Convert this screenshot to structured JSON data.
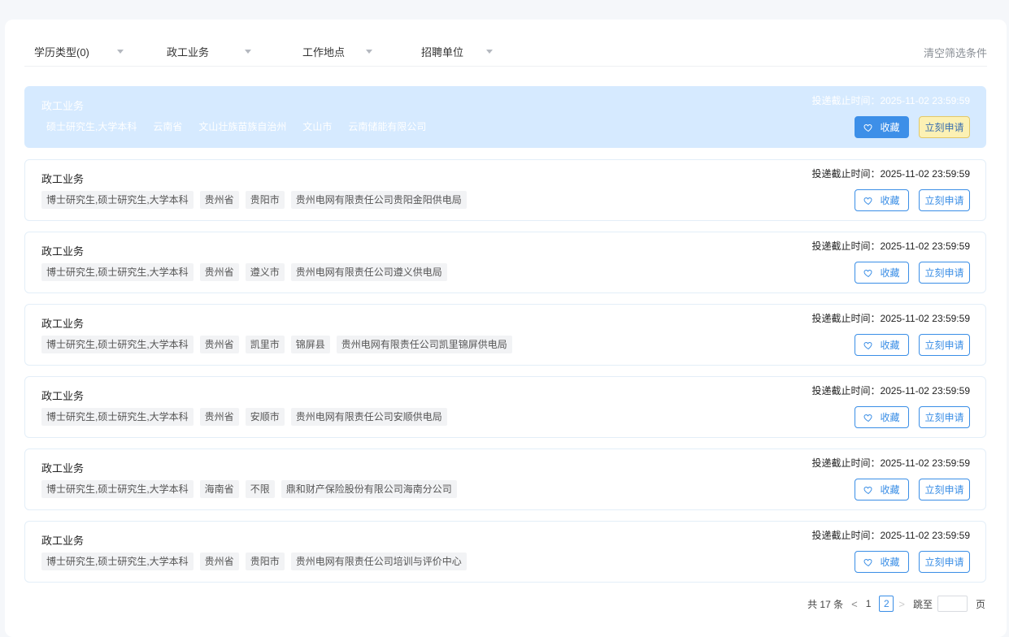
{
  "filters": [
    {
      "label": "学历类型(0)"
    },
    {
      "label": "政工业务"
    },
    {
      "label": "工作地点"
    },
    {
      "label": "招聘单位"
    }
  ],
  "clear_label": "清空筛选条件",
  "cards": [
    {
      "title": "政工业务",
      "tags": [
        "硕士研究生,大学本科",
        "云南省",
        "文山壮族苗族自治州",
        "文山市",
        "云南储能有限公司"
      ],
      "deadline": "投递截止时间：2025-11-02 23:59:59",
      "fav": "收藏",
      "apply": "立刻申请"
    },
    {
      "title": "政工业务",
      "tags": [
        "博士研究生,硕士研究生,大学本科",
        "贵州省",
        "贵阳市",
        "贵州电网有限责任公司贵阳金阳供电局"
      ],
      "deadline": "投递截止时间：2025-11-02 23:59:59",
      "fav": "收藏",
      "apply": "立刻申请"
    },
    {
      "title": "政工业务",
      "tags": [
        "博士研究生,硕士研究生,大学本科",
        "贵州省",
        "遵义市",
        "贵州电网有限责任公司遵义供电局"
      ],
      "deadline": "投递截止时间：2025-11-02 23:59:59",
      "fav": "收藏",
      "apply": "立刻申请"
    },
    {
      "title": "政工业务",
      "tags": [
        "博士研究生,硕士研究生,大学本科",
        "贵州省",
        "凯里市",
        "锦屏县",
        "贵州电网有限责任公司凯里锦屏供电局"
      ],
      "deadline": "投递截止时间：2025-11-02 23:59:59",
      "fav": "收藏",
      "apply": "立刻申请"
    },
    {
      "title": "政工业务",
      "tags": [
        "博士研究生,硕士研究生,大学本科",
        "贵州省",
        "安顺市",
        "贵州电网有限责任公司安顺供电局"
      ],
      "deadline": "投递截止时间：2025-11-02 23:59:59",
      "fav": "收藏",
      "apply": "立刻申请"
    },
    {
      "title": "政工业务",
      "tags": [
        "博士研究生,硕士研究生,大学本科",
        "海南省",
        "不限",
        "鼎和财产保险股份有限公司海南分公司"
      ],
      "deadline": "投递截止时间：2025-11-02 23:59:59",
      "fav": "收藏",
      "apply": "立刻申请"
    },
    {
      "title": "政工业务",
      "tags": [
        "博士研究生,硕士研究生,大学本科",
        "贵州省",
        "贵阳市",
        "贵州电网有限责任公司培训与评价中心"
      ],
      "deadline": "投递截止时间：2025-11-02 23:59:59",
      "fav": "收藏",
      "apply": "立刻申请"
    }
  ],
  "pager": {
    "total": "共 17 条",
    "prev": "<",
    "pages": [
      "1",
      "2"
    ],
    "current": "2",
    "next": ">",
    "jump_label": "跳至",
    "jump_value": "",
    "page_suffix": "页"
  }
}
